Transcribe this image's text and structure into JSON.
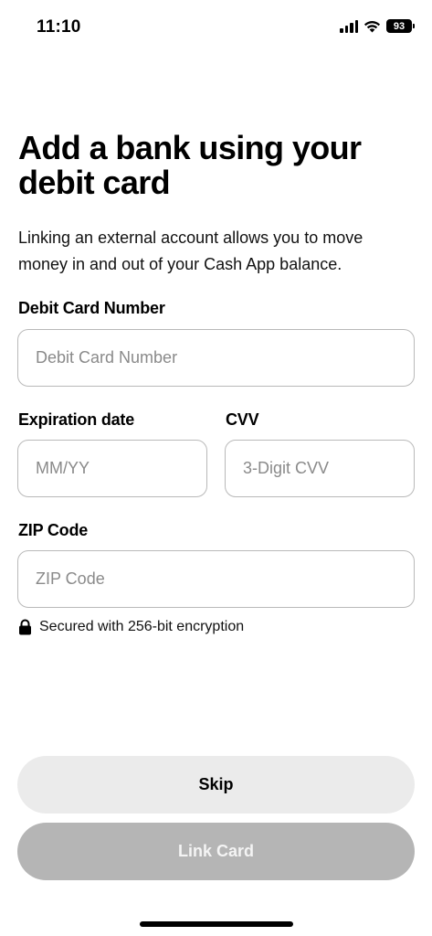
{
  "status_bar": {
    "time": "11:10",
    "battery": "93"
  },
  "title": "Add a bank using your debit card",
  "description": "Linking an external account allows you to move money in and out of your Cash App balance.",
  "fields": {
    "card_number": {
      "label": "Debit Card Number",
      "placeholder": "Debit Card Number",
      "value": ""
    },
    "expiration": {
      "label": "Expiration date",
      "placeholder": "MM/YY",
      "value": ""
    },
    "cvv": {
      "label": "CVV",
      "placeholder": "3-Digit CVV",
      "value": ""
    },
    "zip": {
      "label": "ZIP Code",
      "placeholder": "ZIP Code",
      "value": ""
    }
  },
  "security_note": "Secured with 256-bit encryption",
  "buttons": {
    "skip": "Skip",
    "link_card": "Link Card"
  },
  "colors": {
    "disabled_button": "#b5b5b5",
    "secondary_button": "#ebebeb",
    "field_border": "#b9b9b9"
  },
  "icons": [
    "signal-icon",
    "wifi-icon",
    "battery-icon",
    "lock-icon"
  ]
}
